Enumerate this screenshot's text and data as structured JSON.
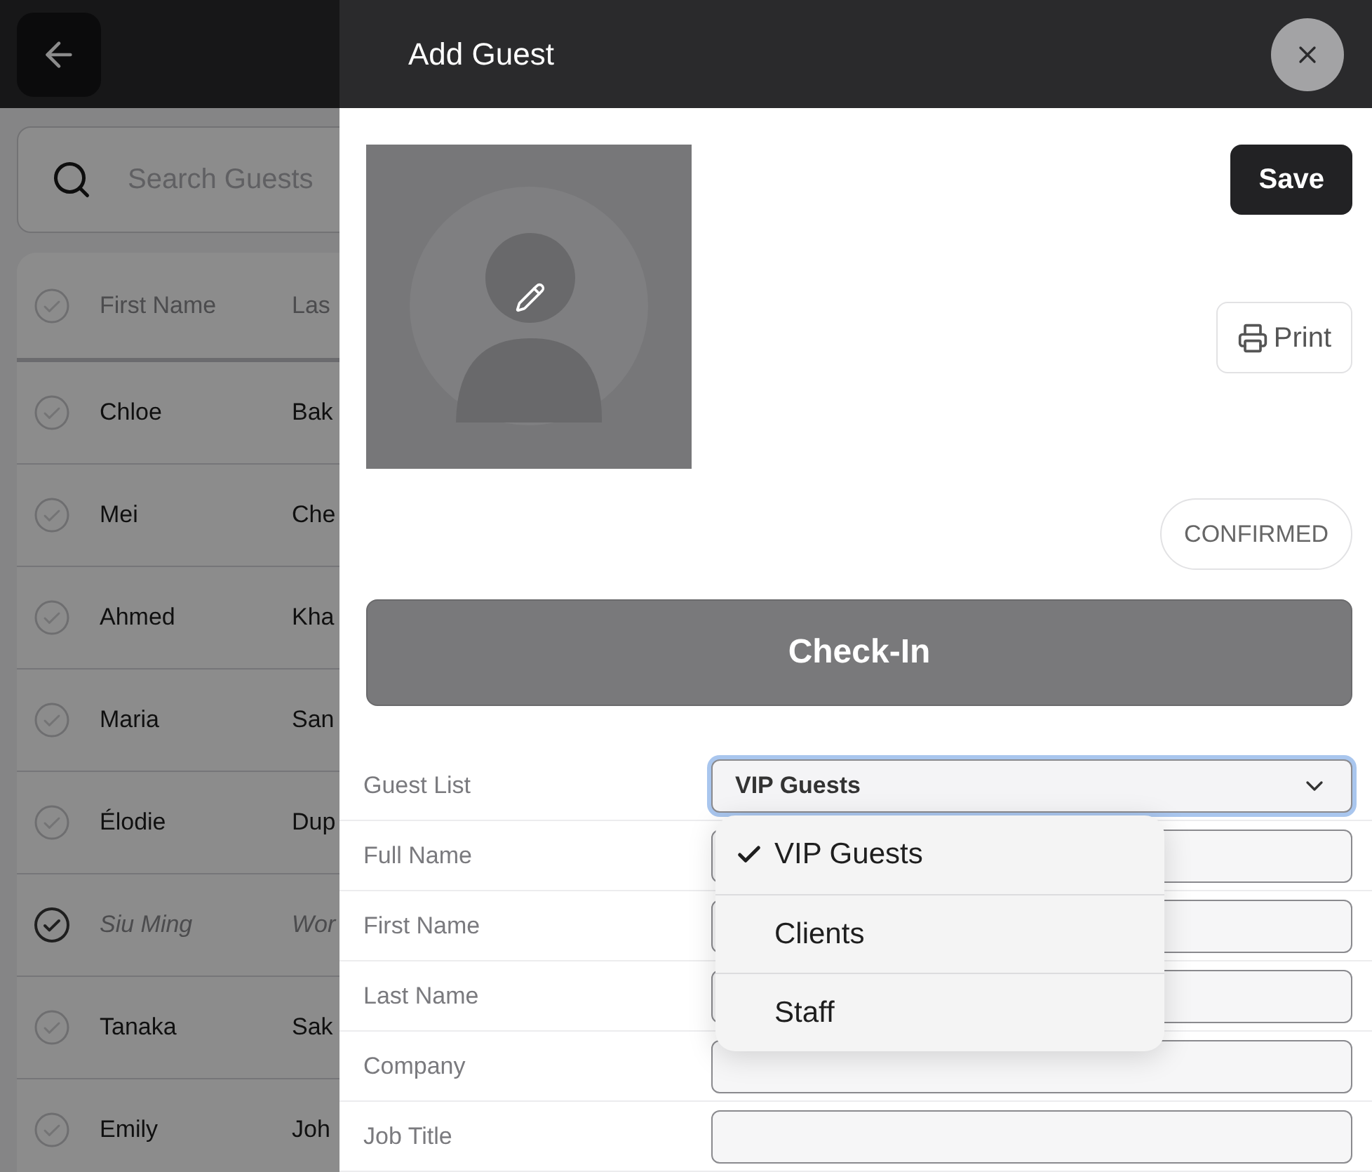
{
  "search": {
    "placeholder": "Search Guests"
  },
  "table": {
    "columns": [
      "First Name",
      "Las"
    ],
    "rows": [
      {
        "first_name": "Chloe",
        "last_name": "Bak",
        "checked": false
      },
      {
        "first_name": "Mei",
        "last_name": "Che",
        "checked": false
      },
      {
        "first_name": "Ahmed",
        "last_name": "Kha",
        "checked": false
      },
      {
        "first_name": "Maria",
        "last_name": "San",
        "checked": false
      },
      {
        "first_name": "Élodie",
        "last_name": "Dup",
        "checked": false
      },
      {
        "first_name": "Siu Ming",
        "last_name": "Wor",
        "checked": true
      },
      {
        "first_name": "Tanaka",
        "last_name": "Sak",
        "checked": false
      },
      {
        "first_name": "Emily",
        "last_name": "Joh",
        "checked": false
      }
    ]
  },
  "panel": {
    "title": "Add Guest",
    "save": "Save",
    "print": "Print",
    "status": "CONFIRMED",
    "check_in": "Check-In",
    "fields": [
      {
        "label": "Guest List",
        "kind": "select",
        "value": "VIP Guests",
        "expanded": true
      },
      {
        "label": "Full Name",
        "kind": "text"
      },
      {
        "label": "First Name",
        "kind": "text"
      },
      {
        "label": "Last Name",
        "kind": "text"
      },
      {
        "label": "Company",
        "kind": "text"
      },
      {
        "label": "Job Title",
        "kind": "text"
      }
    ],
    "options": [
      {
        "label": "VIP Guests",
        "selected": true
      },
      {
        "label": "Clients",
        "selected": false
      },
      {
        "label": "Staff",
        "selected": false
      }
    ]
  }
}
